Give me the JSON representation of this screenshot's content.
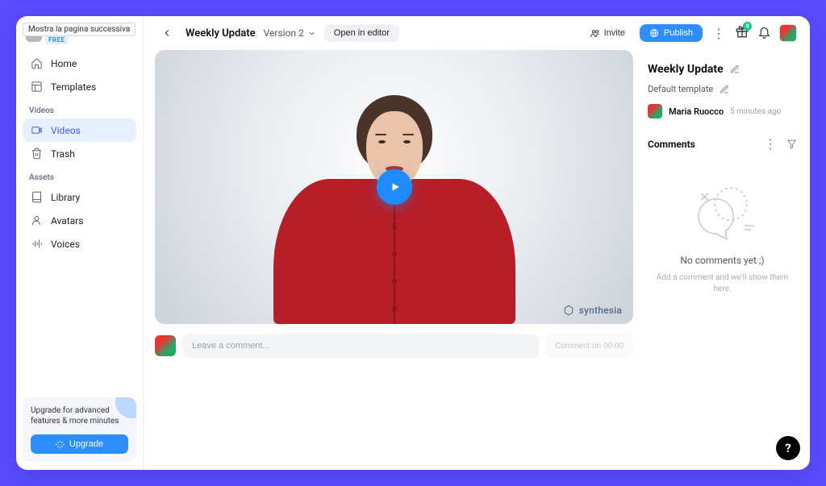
{
  "tooltip": "Mostra la pagina successiva",
  "workspace": {
    "plan_badge": "FREE"
  },
  "sidebar": {
    "home": "Home",
    "templates": "Templates",
    "videos_section": "Videos",
    "videos": "Videos",
    "trash": "Trash",
    "assets_section": "Assets",
    "library": "Library",
    "avatars": "Avatars",
    "voices": "Voices"
  },
  "upgrade": {
    "text": "Upgrade for advanced features & more minutes",
    "button": "Upgrade"
  },
  "topbar": {
    "title": "Weekly Update",
    "version": "Version 2",
    "open_editor": "Open in editor",
    "invite": "Invite",
    "publish": "Publish",
    "gift_badge": "9"
  },
  "video": {
    "watermark": "synthesia"
  },
  "comment_input": {
    "placeholder": "Leave a comment...",
    "time_button": "Comment on 00:00"
  },
  "rightpanel": {
    "title": "Weekly Update",
    "subtitle": "Default template",
    "author": "Maria Ruocco",
    "timestamp": "5 minutes ago",
    "comments_header": "Comments",
    "empty_title": "No comments yet ;)",
    "empty_sub": "Add a comment and we'll show them here."
  },
  "fab": "?"
}
